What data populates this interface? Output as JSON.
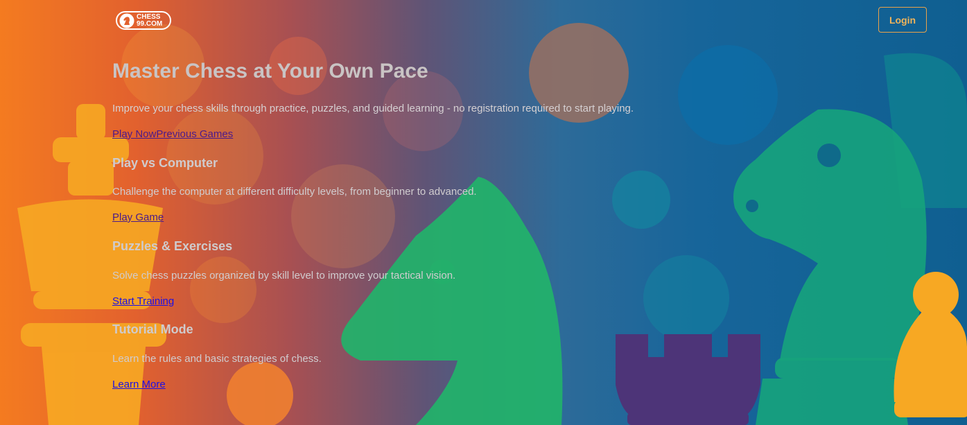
{
  "brand": {
    "logo_line1": "CHESS",
    "logo_line2": "99.COM"
  },
  "header": {
    "login_label": "Login"
  },
  "hero": {
    "title": "Master Chess at Your Own Pace",
    "subtitle": "Improve your chess skills through practice, puzzles, and guided learning - no registration required to start playing.",
    "play_now": "Play Now",
    "previous_games": "Previous Games"
  },
  "sections": [
    {
      "title": "Play vs Computer",
      "description": "Challenge the computer at different difficulty levels, from beginner to advanced.",
      "link": "Play Game"
    },
    {
      "title": "Puzzles & Exercises",
      "description": "Solve chess puzzles organized by skill level to improve your tactical vision.",
      "link": "Start Training"
    },
    {
      "title": "Tutorial Mode",
      "description": "Learn the rules and basic strategies of chess.",
      "link": "Learn More"
    }
  ],
  "colors": {
    "accent_orange": "#f47b20",
    "knight_green": "#22b36a",
    "rook_purple": "#4d3478",
    "king_yellow": "#f7a823",
    "login_border": "#e9a24a"
  },
  "icons": [
    "knight-logo-icon",
    "king-piece-illustration",
    "knight-piece-illustration",
    "rook-piece-illustration",
    "pawn-piece-illustration"
  ]
}
